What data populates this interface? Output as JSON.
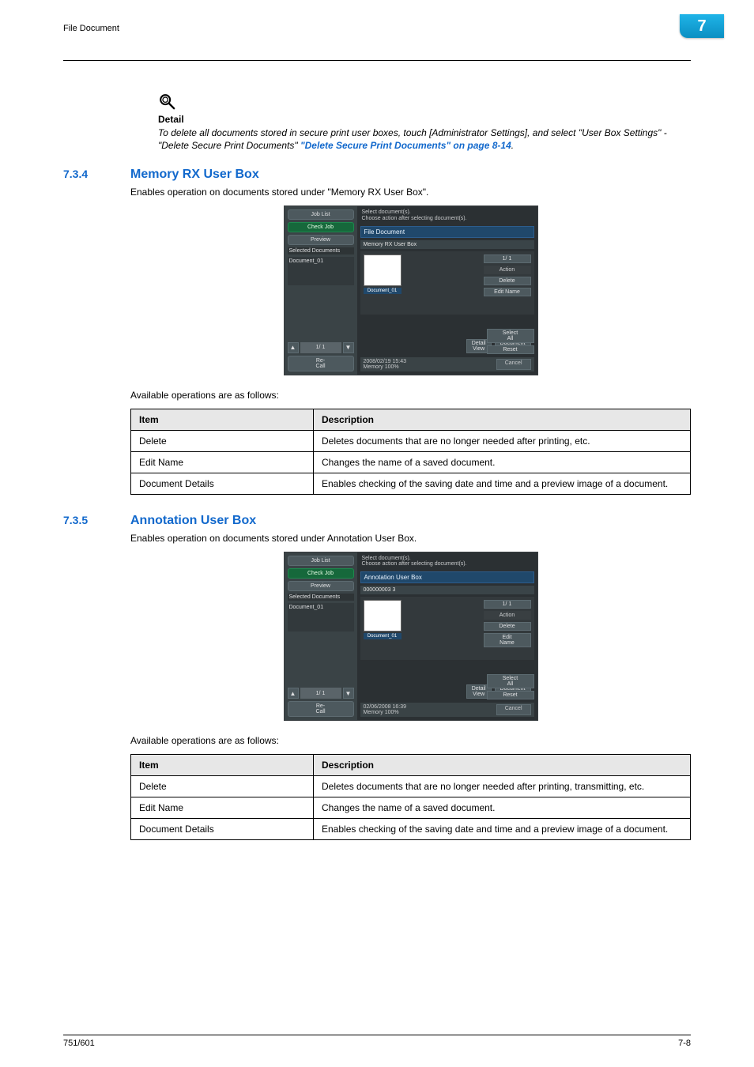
{
  "header": {
    "breadcrumb": "File Document",
    "chapter_number": "7"
  },
  "detail_block": {
    "heading": "Detail",
    "text_prefix": "To delete all documents stored in secure print user boxes, touch [Administrator Settings], and select \"User Box Settings\" - \"Delete Secure Print Documents\"",
    "link_text": "\"Delete Secure Print Documents\" on page 8-14",
    "text_suffix": "."
  },
  "sections": [
    {
      "number": "7.3.4",
      "title": "Memory RX User Box",
      "intro": "Enables operation on documents stored under \"Memory RX User Box\".",
      "available_text": "Available operations are as follows:",
      "table_header": {
        "item": "Item",
        "description": "Description"
      },
      "table_rows": [
        {
          "item": "Delete",
          "description": "Deletes documents that are no longer needed after printing, etc."
        },
        {
          "item": "Edit Name",
          "description": "Changes the name of a saved document."
        },
        {
          "item": "Document Details",
          "description": "Enables checking of the saving date and time and a preview image of a document."
        }
      ],
      "shot": {
        "top_text": "Select document(s).\nChoose action after selecting document(s).",
        "job_list": "Job List",
        "check_job": "Check Job",
        "preview": "Preview",
        "sel_docs": "Selected Documents",
        "doc_entry": "Document_01",
        "pager_page": "1/  1",
        "re_call": "Re-\nCall",
        "title_bar": "File Document",
        "sub_bar": "Memory RX User Box",
        "thumb_caption": "Document_01",
        "right": {
          "page": "1/  1",
          "action": "Action",
          "delete": "Delete",
          "edit_name": "Edit Name",
          "select_all": "Select\nAll",
          "reset": "Reset",
          "detail_view": "Detail\nView",
          "doc_details": "Document\nDetails",
          "cancel": "Cancel"
        },
        "status_left": "2008/02/19    15:43\nMemory        100%"
      }
    },
    {
      "number": "7.3.5",
      "title": "Annotation User Box",
      "intro": "Enables operation on documents stored under Annotation User Box.",
      "available_text": "Available operations are as follows:",
      "table_header": {
        "item": "Item",
        "description": "Description"
      },
      "table_rows": [
        {
          "item": "Delete",
          "description": "Deletes documents that are no longer needed after printing, transmitting, etc."
        },
        {
          "item": "Edit Name",
          "description": "Changes the name of a saved document."
        },
        {
          "item": "Document Details",
          "description": "Enables checking of the saving date and time and a preview image of a document."
        }
      ],
      "shot": {
        "top_text": "Select document(s).\nChoose action after selecting document(s).",
        "job_list": "Job List",
        "check_job": "Check Job",
        "preview": "Preview",
        "sel_docs": "Selected Documents",
        "doc_entry": "Document_01",
        "pager_page": "1/  1",
        "re_call": "Re-\nCall",
        "title_bar": "Annotation User Box",
        "sub_bar": "000000003   3",
        "thumb_caption": "Document_01",
        "right": {
          "page": "1/  1",
          "action": "Action",
          "delete": "Delete",
          "edit_name": "Edit\nName",
          "select_all": "Select\nAll",
          "reset": "Reset",
          "detail_view": "Detail\nView",
          "doc_details": "Document\nDetails",
          "cancel": "Cancel"
        },
        "status_left": "02/06/2008    16:39\nMemory        100%"
      }
    }
  ],
  "footer": {
    "left": "751/601",
    "right": "7-8"
  }
}
